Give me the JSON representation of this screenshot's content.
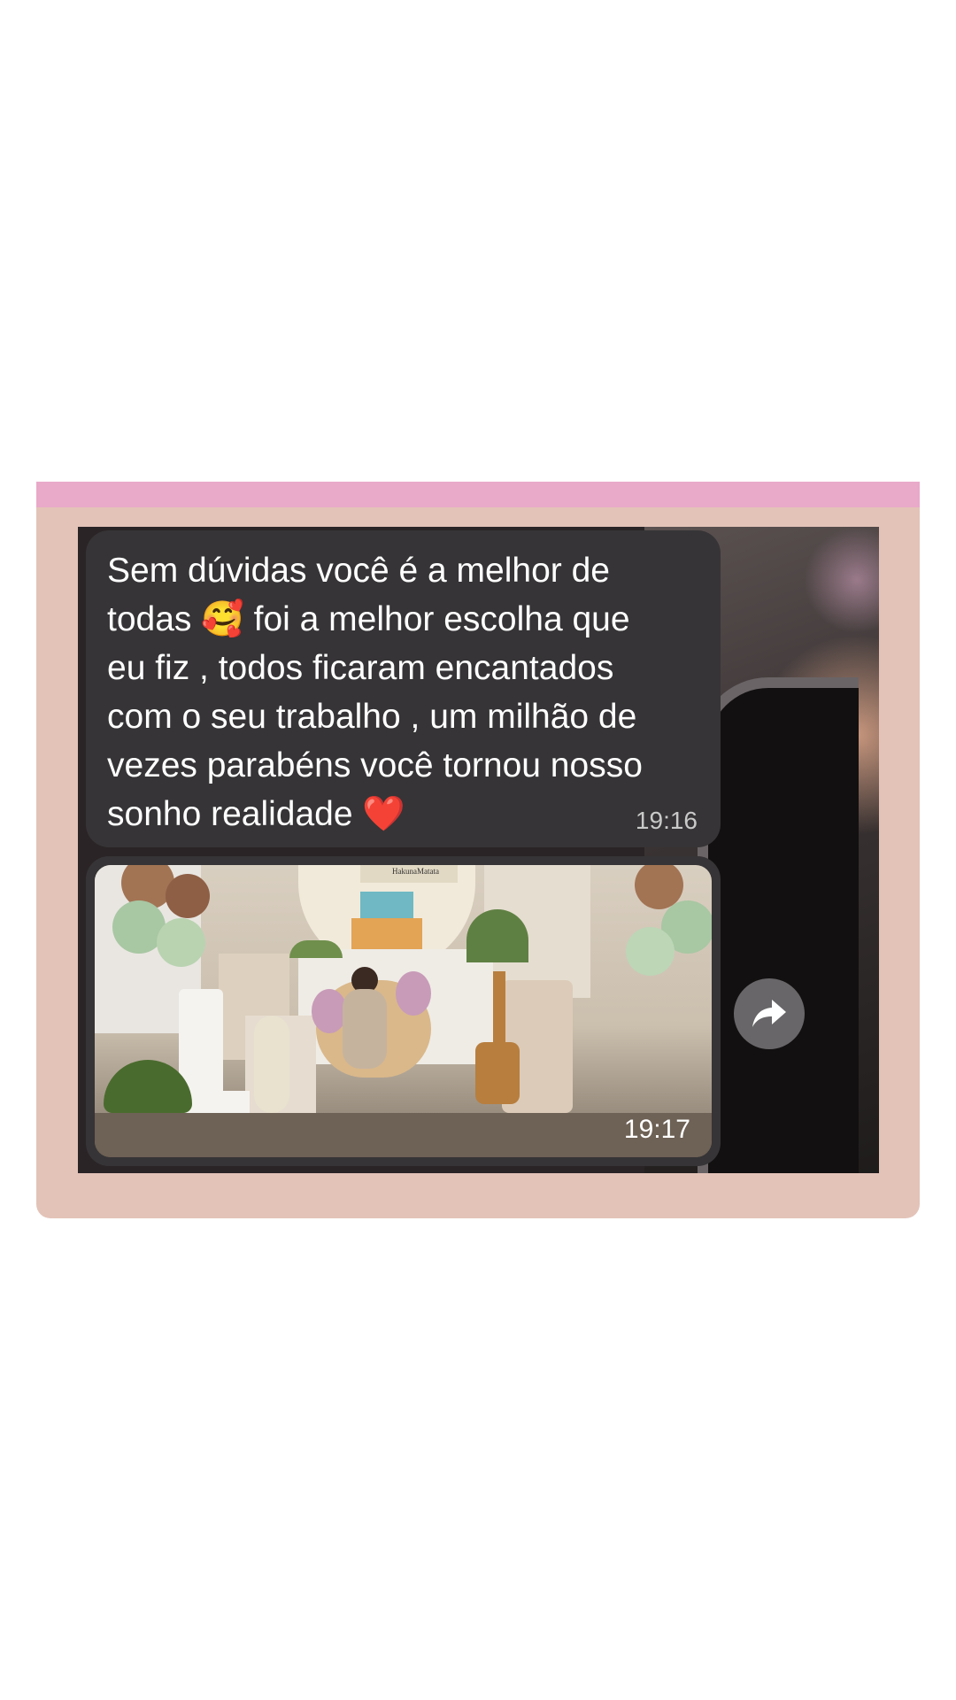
{
  "chat": {
    "message_text": "Sem dúvidas você é a melhor de\ntodas 🥰 foi a melhor escolha que\neu fiz , todos ficaram encantados\ncom o seu trabalho , um milhão de\nvezes parabéns você tornou nosso\nsonho realidade ❤️",
    "message_time": "19:16",
    "photo_time": "19:17",
    "photo_banner_text": "HakunaMatata"
  },
  "icons": {
    "forward": "forward-arrow-icon"
  },
  "colors": {
    "top_bar": "#e9a9c9",
    "card_bg": "#e3c3b8",
    "bubble_bg": "#363436"
  }
}
